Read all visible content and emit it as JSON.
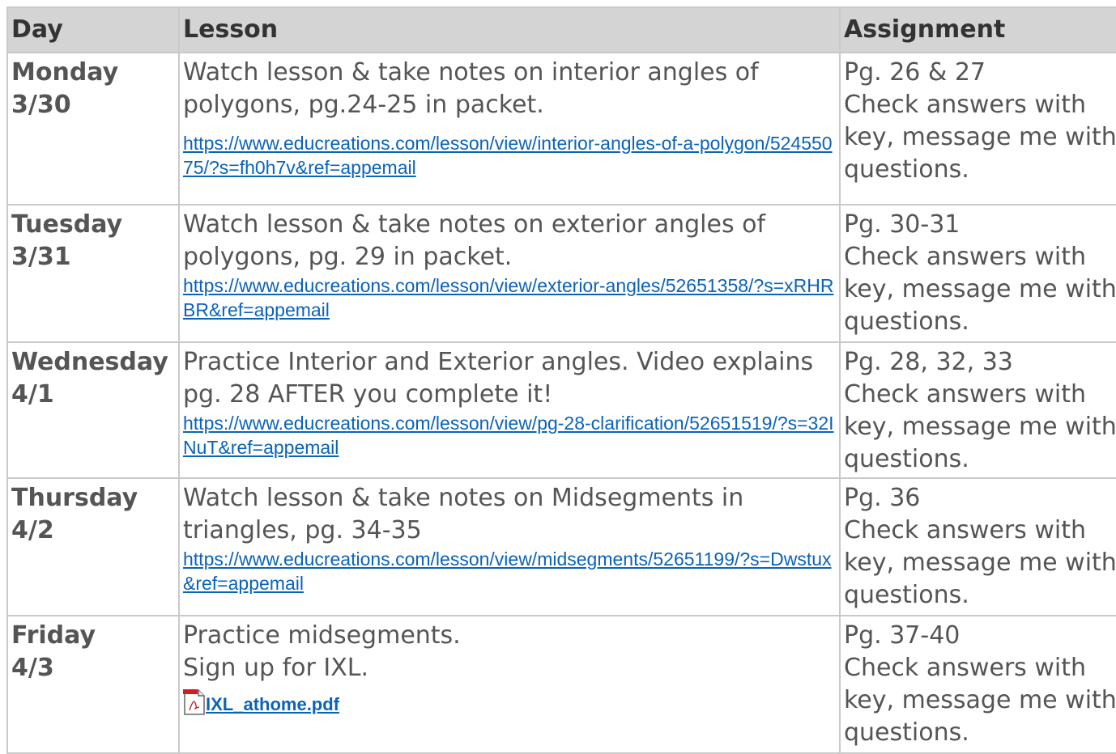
{
  "headers": {
    "day": "Day",
    "lesson": "Lesson",
    "assignment": "Assignment"
  },
  "rows": [
    {
      "day": "Monday",
      "date": "3/30",
      "lesson_text": "Watch lesson & take notes on interior angles of polygons, pg.24-25 in packet.",
      "link": "https://www.educreations.com/lesson/view/interior-angles-of-a-polygon/52455075/?s=fh0h7v&ref=appemail",
      "assignment_pages": "Pg. 26 & 27",
      "assignment_note": "Check answers with key, message me with questions."
    },
    {
      "day": "Tuesday",
      "date": "3/31",
      "lesson_text": "Watch lesson & take notes on exterior angles of polygons, pg. 29 in packet.",
      "link": "https://www.educreations.com/lesson/view/exterior-angles/52651358/?s=xRHRBR&ref=appemail",
      "assignment_pages": "Pg. 30-31",
      "assignment_note": "Check answers with key, message me with questions."
    },
    {
      "day": "Wednesday",
      "date": "4/1",
      "lesson_text": "Practice Interior and Exterior angles. Video explains pg. 28 AFTER you complete it!",
      "link": "https://www.educreations.com/lesson/view/pg-28-clarification/52651519/?s=32INuT&ref=appemail",
      "assignment_pages": "Pg. 28, 32, 33",
      "assignment_note": "Check answers with key, message me with questions."
    },
    {
      "day": "Thursday",
      "date": "4/2",
      "lesson_text": "Watch lesson & take notes on Midsegments in triangles, pg. 34-35",
      "link": "https://www.educreations.com/lesson/view/midsegments/52651199/?s=Dwstux&ref=appemail",
      "assignment_pages": "Pg. 36",
      "assignment_note": "Check answers with key, message me with questions."
    },
    {
      "day": "Friday",
      "date": "4/3",
      "lesson_line1": "Practice midsegments.",
      "lesson_line2": "Sign up for IXL.",
      "attachment": "IXL_athome.pdf",
      "attachment_icon": "pdf-file-icon",
      "assignment_pages": "Pg. 37-40",
      "assignment_note": "Check answers with key, message me with questions."
    }
  ],
  "colors": {
    "header_bg": "#d4d4d4",
    "text": "#555555",
    "link": "#0b63b8",
    "border": "#c9c9c9"
  }
}
